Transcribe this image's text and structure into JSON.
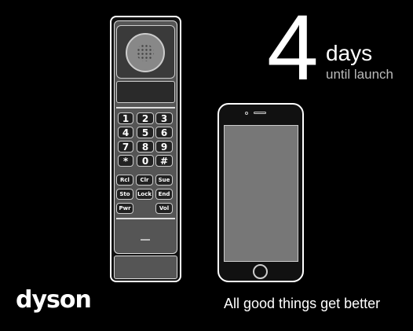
{
  "countdown": {
    "number": "4",
    "unit": "days",
    "caption": "until launch"
  },
  "brand": {
    "logo": "dyson"
  },
  "tagline": "All good things get better",
  "handset": {
    "keys": [
      "1",
      "2",
      "3",
      "4",
      "5",
      "6",
      "7",
      "8",
      "9",
      "*",
      "0",
      "#"
    ],
    "function_keys": [
      "Rcl",
      "Clr",
      "Sue",
      "Sto",
      "Lock",
      "End",
      "Pwr",
      "Vol"
    ]
  },
  "colors": {
    "background": "#000000",
    "outline": "#ffffff",
    "body": "#555555"
  }
}
